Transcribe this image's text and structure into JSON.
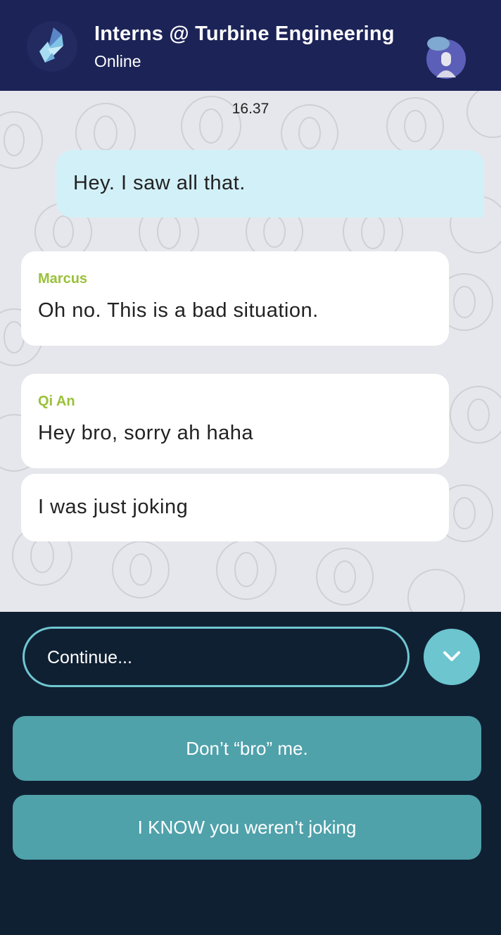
{
  "header": {
    "title": "Interns @ Turbine Engineering",
    "status": "Online",
    "logo_icon": "kite-logo-icon",
    "avatar_icon": "group-avatar-icon"
  },
  "chat": {
    "timestamp": "16.37",
    "messages": [
      {
        "direction": "outgoing",
        "sender": "",
        "text": "Hey. I saw all that."
      },
      {
        "direction": "incoming",
        "sender": "Marcus",
        "text": "Oh no. This is a bad situation."
      },
      {
        "direction": "incoming",
        "sender": "Qi An",
        "text": "Hey bro, sorry ah haha"
      },
      {
        "direction": "incoming",
        "sender": "",
        "text": "I was just joking"
      }
    ]
  },
  "composer": {
    "placeholder": "Continue...",
    "expand_icon": "chevron-down-icon",
    "choices": [
      {
        "label": "Don’t “bro” me."
      },
      {
        "label": "I KNOW you weren’t joking"
      }
    ]
  },
  "colors": {
    "header_bg": "#1c2357",
    "chat_bg": "#e6e7ec",
    "outgoing_bubble": "#d2f0f7",
    "incoming_bubble": "#ffffff",
    "sender_name": "#9ac13a",
    "bottom_bg": "#102033",
    "choice_button": "#4fa1aa",
    "accent": "#6cc5cf"
  }
}
